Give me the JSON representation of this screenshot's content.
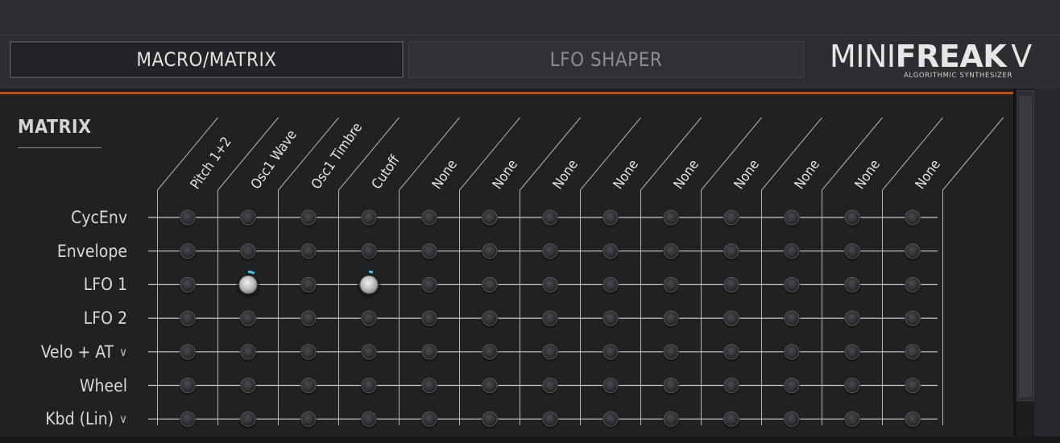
{
  "tabs": {
    "macro_matrix": "MACRO/MATRIX",
    "lfo_shaper": "LFO SHAPER"
  },
  "brand": {
    "mini": "MINI",
    "freak": "FREAK",
    "v": "V",
    "subtitle": "ALGORITHMIC SYNTHESIZER"
  },
  "matrix": {
    "title": "MATRIX",
    "rows": [
      {
        "label": "CycEnv",
        "dropdown": false
      },
      {
        "label": "Envelope",
        "dropdown": false
      },
      {
        "label": "LFO 1",
        "dropdown": false
      },
      {
        "label": "LFO 2",
        "dropdown": false
      },
      {
        "label": "Velo + AT",
        "dropdown": true
      },
      {
        "label": "Wheel",
        "dropdown": false
      },
      {
        "label": "Kbd (Lin)",
        "dropdown": true
      }
    ],
    "columns": [
      "Pitch 1+2",
      "Osc1 Wave",
      "Osc1 Timbre",
      "Cutoff",
      "None",
      "None",
      "None",
      "None",
      "None",
      "None",
      "None",
      "None",
      "None"
    ],
    "active_cells": [
      {
        "row": 2,
        "col": 1,
        "amount": 0.08
      },
      {
        "row": 2,
        "col": 3,
        "amount": 0.05
      }
    ],
    "chevron_icon": "chevron-down-icon",
    "colors": {
      "accent_orange": "#c14a17",
      "amount_indicator": "#3fc6e8"
    }
  }
}
